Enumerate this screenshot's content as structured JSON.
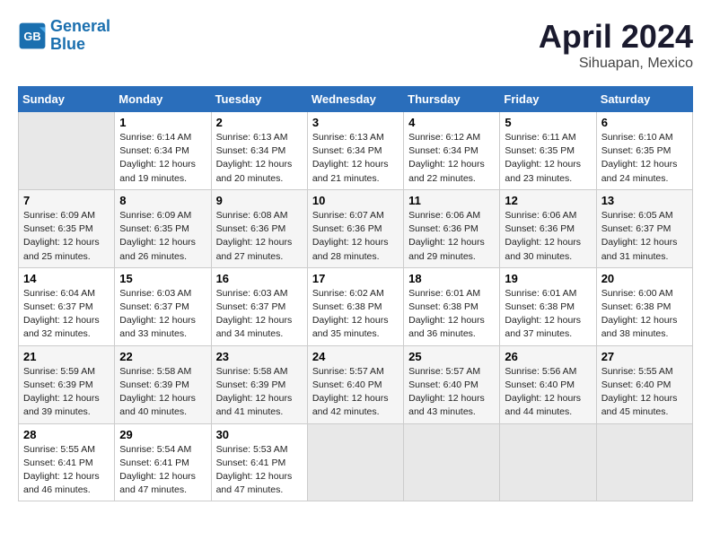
{
  "header": {
    "logo_line1": "General",
    "logo_line2": "Blue",
    "title": "April 2024",
    "subtitle": "Sihuapan, Mexico"
  },
  "days_of_week": [
    "Sunday",
    "Monday",
    "Tuesday",
    "Wednesday",
    "Thursday",
    "Friday",
    "Saturday"
  ],
  "weeks": [
    [
      {
        "num": "",
        "info": ""
      },
      {
        "num": "1",
        "info": "Sunrise: 6:14 AM\nSunset: 6:34 PM\nDaylight: 12 hours\nand 19 minutes."
      },
      {
        "num": "2",
        "info": "Sunrise: 6:13 AM\nSunset: 6:34 PM\nDaylight: 12 hours\nand 20 minutes."
      },
      {
        "num": "3",
        "info": "Sunrise: 6:13 AM\nSunset: 6:34 PM\nDaylight: 12 hours\nand 21 minutes."
      },
      {
        "num": "4",
        "info": "Sunrise: 6:12 AM\nSunset: 6:34 PM\nDaylight: 12 hours\nand 22 minutes."
      },
      {
        "num": "5",
        "info": "Sunrise: 6:11 AM\nSunset: 6:35 PM\nDaylight: 12 hours\nand 23 minutes."
      },
      {
        "num": "6",
        "info": "Sunrise: 6:10 AM\nSunset: 6:35 PM\nDaylight: 12 hours\nand 24 minutes."
      }
    ],
    [
      {
        "num": "7",
        "info": "Sunrise: 6:09 AM\nSunset: 6:35 PM\nDaylight: 12 hours\nand 25 minutes."
      },
      {
        "num": "8",
        "info": "Sunrise: 6:09 AM\nSunset: 6:35 PM\nDaylight: 12 hours\nand 26 minutes."
      },
      {
        "num": "9",
        "info": "Sunrise: 6:08 AM\nSunset: 6:36 PM\nDaylight: 12 hours\nand 27 minutes."
      },
      {
        "num": "10",
        "info": "Sunrise: 6:07 AM\nSunset: 6:36 PM\nDaylight: 12 hours\nand 28 minutes."
      },
      {
        "num": "11",
        "info": "Sunrise: 6:06 AM\nSunset: 6:36 PM\nDaylight: 12 hours\nand 29 minutes."
      },
      {
        "num": "12",
        "info": "Sunrise: 6:06 AM\nSunset: 6:36 PM\nDaylight: 12 hours\nand 30 minutes."
      },
      {
        "num": "13",
        "info": "Sunrise: 6:05 AM\nSunset: 6:37 PM\nDaylight: 12 hours\nand 31 minutes."
      }
    ],
    [
      {
        "num": "14",
        "info": "Sunrise: 6:04 AM\nSunset: 6:37 PM\nDaylight: 12 hours\nand 32 minutes."
      },
      {
        "num": "15",
        "info": "Sunrise: 6:03 AM\nSunset: 6:37 PM\nDaylight: 12 hours\nand 33 minutes."
      },
      {
        "num": "16",
        "info": "Sunrise: 6:03 AM\nSunset: 6:37 PM\nDaylight: 12 hours\nand 34 minutes."
      },
      {
        "num": "17",
        "info": "Sunrise: 6:02 AM\nSunset: 6:38 PM\nDaylight: 12 hours\nand 35 minutes."
      },
      {
        "num": "18",
        "info": "Sunrise: 6:01 AM\nSunset: 6:38 PM\nDaylight: 12 hours\nand 36 minutes."
      },
      {
        "num": "19",
        "info": "Sunrise: 6:01 AM\nSunset: 6:38 PM\nDaylight: 12 hours\nand 37 minutes."
      },
      {
        "num": "20",
        "info": "Sunrise: 6:00 AM\nSunset: 6:38 PM\nDaylight: 12 hours\nand 38 minutes."
      }
    ],
    [
      {
        "num": "21",
        "info": "Sunrise: 5:59 AM\nSunset: 6:39 PM\nDaylight: 12 hours\nand 39 minutes."
      },
      {
        "num": "22",
        "info": "Sunrise: 5:58 AM\nSunset: 6:39 PM\nDaylight: 12 hours\nand 40 minutes."
      },
      {
        "num": "23",
        "info": "Sunrise: 5:58 AM\nSunset: 6:39 PM\nDaylight: 12 hours\nand 41 minutes."
      },
      {
        "num": "24",
        "info": "Sunrise: 5:57 AM\nSunset: 6:40 PM\nDaylight: 12 hours\nand 42 minutes."
      },
      {
        "num": "25",
        "info": "Sunrise: 5:57 AM\nSunset: 6:40 PM\nDaylight: 12 hours\nand 43 minutes."
      },
      {
        "num": "26",
        "info": "Sunrise: 5:56 AM\nSunset: 6:40 PM\nDaylight: 12 hours\nand 44 minutes."
      },
      {
        "num": "27",
        "info": "Sunrise: 5:55 AM\nSunset: 6:40 PM\nDaylight: 12 hours\nand 45 minutes."
      }
    ],
    [
      {
        "num": "28",
        "info": "Sunrise: 5:55 AM\nSunset: 6:41 PM\nDaylight: 12 hours\nand 46 minutes."
      },
      {
        "num": "29",
        "info": "Sunrise: 5:54 AM\nSunset: 6:41 PM\nDaylight: 12 hours\nand 47 minutes."
      },
      {
        "num": "30",
        "info": "Sunrise: 5:53 AM\nSunset: 6:41 PM\nDaylight: 12 hours\nand 47 minutes."
      },
      {
        "num": "",
        "info": ""
      },
      {
        "num": "",
        "info": ""
      },
      {
        "num": "",
        "info": ""
      },
      {
        "num": "",
        "info": ""
      }
    ]
  ]
}
